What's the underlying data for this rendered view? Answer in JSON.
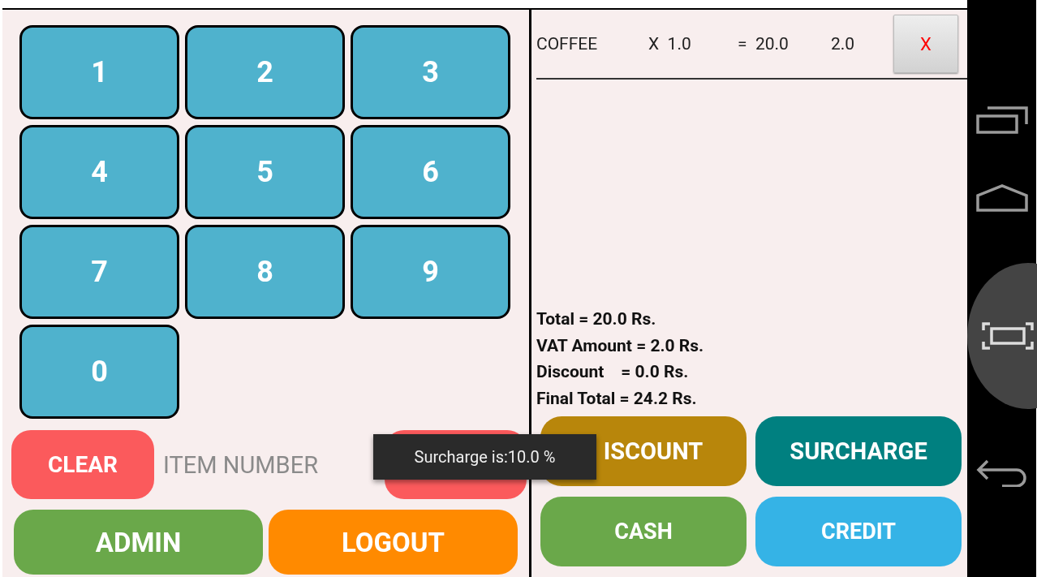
{
  "keypad": {
    "keys": [
      "1",
      "2",
      "3",
      "4",
      "5",
      "6",
      "7",
      "8",
      "9",
      "0"
    ]
  },
  "entry_row": {
    "clear_button": "CLEAR",
    "item_field": {
      "placeholder": "ITEM NUMBER"
    }
  },
  "bottom_buttons": [
    {
      "label": "ADMIN",
      "color": "#6aa84a"
    },
    {
      "label": "LOGOUT",
      "color": "#ff8a00"
    }
  ],
  "order_items": [
    {
      "name": "COFFEE",
      "quantity": "X  1.0",
      "amount": "=  20.0",
      "vat": "2.0",
      "remove_label": "X"
    }
  ],
  "summary": [
    "Total = 20.0 Rs.",
    "VAT Amount = 2.0 Rs.",
    "Discount    = 0.0 Rs.",
    "Final Total = 24.2 Rs."
  ],
  "action_buttons": [
    {
      "label": "ISCOUNT",
      "color": "#b8860b"
    },
    {
      "label": "SURCHARGE",
      "color": "#008080"
    },
    {
      "label": "CASH",
      "color": "#6aa84a"
    },
    {
      "label": "CREDIT",
      "color": "#35b3e6"
    }
  ],
  "toast": {
    "message": "Surcharge is:10.0 %"
  }
}
